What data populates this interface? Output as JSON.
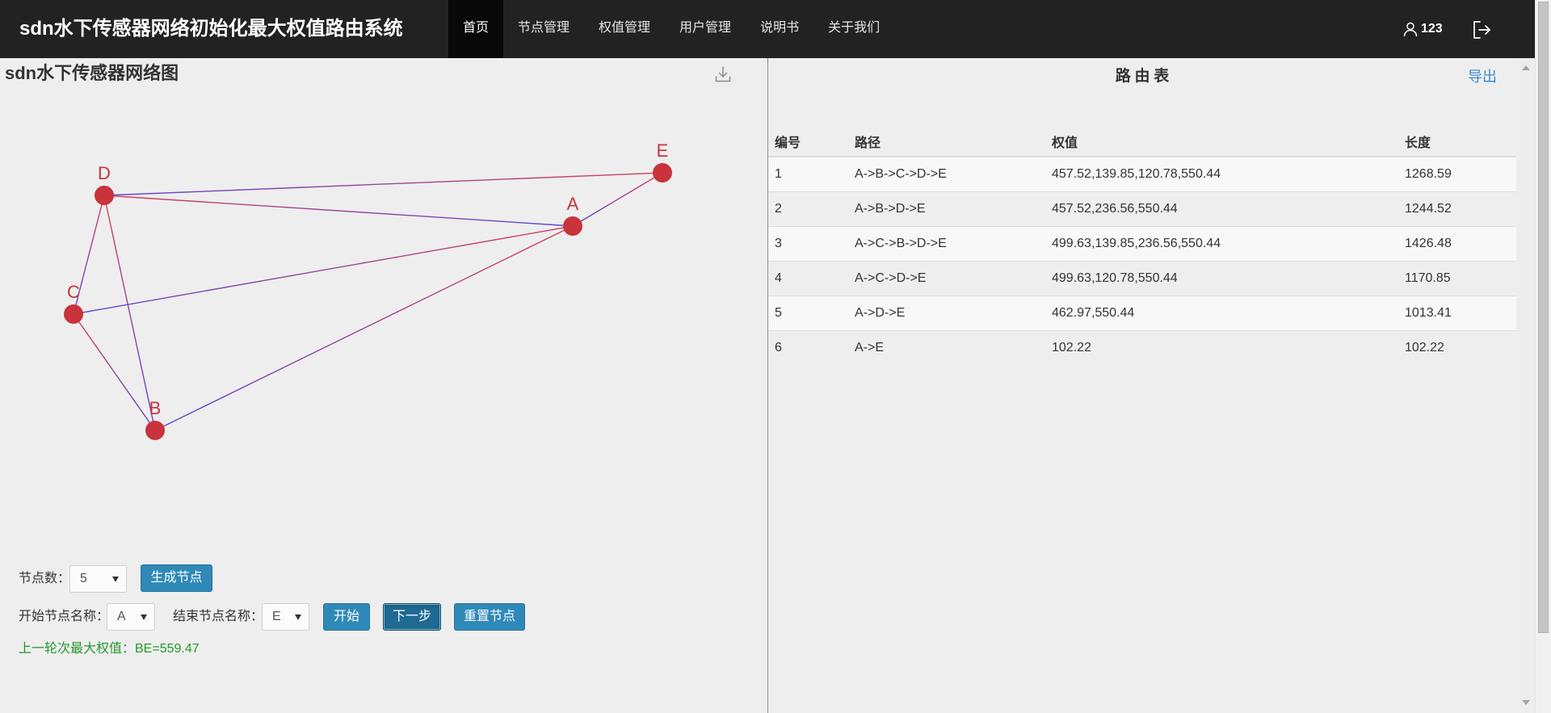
{
  "app": {
    "title": "sdn水下传感器网络初始化最大权值路由系统"
  },
  "nav": {
    "items": [
      {
        "label": "首页",
        "active": true
      },
      {
        "label": "节点管理",
        "active": false
      },
      {
        "label": "权值管理",
        "active": false
      },
      {
        "label": "用户管理",
        "active": false
      },
      {
        "label": "说明书",
        "active": false
      },
      {
        "label": "关于我们",
        "active": false
      }
    ],
    "user": "123",
    "user_icon": "user-icon",
    "logout_icon": "logout-icon"
  },
  "left": {
    "title": "sdn水下传感器网络图",
    "download_icon": "download-icon",
    "graph": {
      "nodes": [
        {
          "name": "D"
        },
        {
          "name": "E"
        },
        {
          "name": "A"
        },
        {
          "name": "C"
        },
        {
          "name": "B"
        }
      ],
      "edges": [
        [
          1,
          0
        ],
        [
          0,
          2
        ],
        [
          1,
          2
        ],
        [
          0,
          3
        ],
        [
          0,
          4
        ],
        [
          2,
          3
        ],
        [
          3,
          4
        ],
        [
          2,
          4
        ]
      ],
      "colors": {
        "node": "#c9333b",
        "edge_start": "#d7425a",
        "edge_end": "#5b46d2"
      }
    },
    "controls": {
      "node_count_label": "节点数：",
      "node_count_value": "5",
      "generate_button": "生成节点",
      "start_label": "开始节点名称：",
      "start_value": "A",
      "end_label": "结束节点名称：",
      "end_value": "E",
      "start_button": "开始",
      "next_button": "下一步",
      "reset_button": "重置节点",
      "status": "上一轮次最大权值：BE=559.47"
    }
  },
  "right": {
    "title": "路 由 表",
    "export": "导出",
    "table": {
      "headers": [
        "编号",
        "路径",
        "权值",
        "长度"
      ],
      "rows": [
        [
          "1",
          "A->B->C->D->E",
          "457.52,139.85,120.78,550.44",
          "1268.59"
        ],
        [
          "2",
          "A->B->D->E",
          "457.52,236.56,550.44",
          "1244.52"
        ],
        [
          "3",
          "A->C->B->D->E",
          "499.63,139.85,236.56,550.44",
          "1426.48"
        ],
        [
          "4",
          "A->C->D->E",
          "499.63,120.78,550.44",
          "1170.85"
        ],
        [
          "5",
          "A->D->E",
          "462.97,550.44",
          "1013.41"
        ],
        [
          "6",
          "A->E",
          "102.22",
          "102.22"
        ]
      ]
    }
  },
  "theme": {
    "navbar_bg": "#222222",
    "nav_active_bg": "#080808",
    "button": "#2f89b8",
    "button_active": "#1e6a92",
    "status_text": "#22992b",
    "link": "#428bca"
  }
}
